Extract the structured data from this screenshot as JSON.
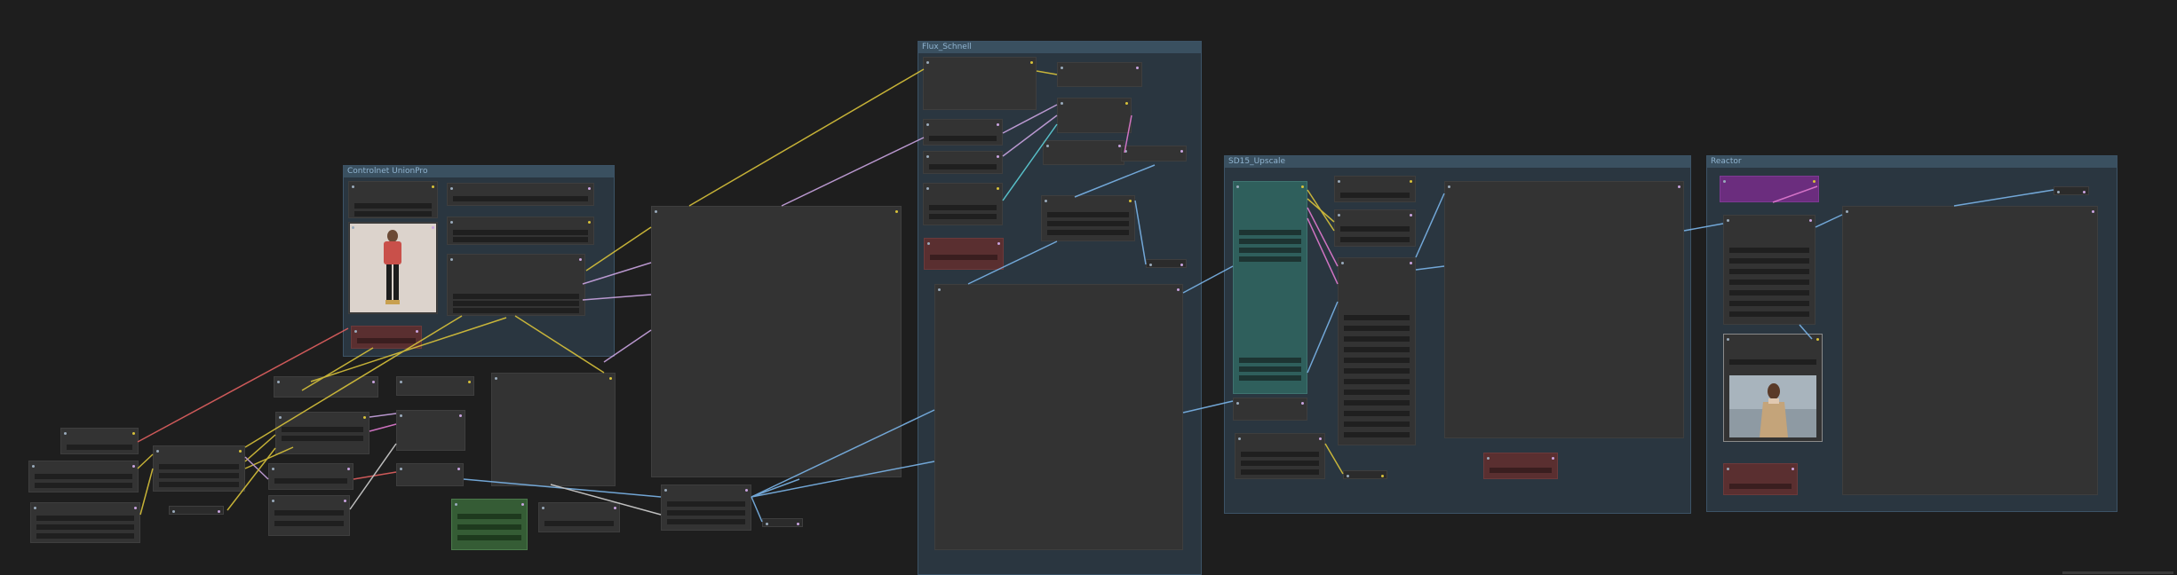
{
  "groups": [
    {
      "id": "controlnet",
      "title": "Controlnet UnionPro"
    },
    {
      "id": "flux",
      "title": "Flux_Schnell"
    },
    {
      "id": "sd15",
      "title": "SD15_Upscale"
    },
    {
      "id": "reactor",
      "title": "Reactor"
    }
  ],
  "wire_colors": {
    "yellow": "#d8c23a",
    "lavender": "#c9a3e0",
    "blue": "#7ab4e8",
    "cyan": "#5ed0d8",
    "pink": "#e07ad0",
    "red": "#e06060",
    "orange": "#e09040",
    "white": "#d0d0d0"
  },
  "images": {
    "controlnet_reference": "woman-standing-in-red-top-image",
    "reactor_output": "woman-in-coat-by-water-image"
  }
}
